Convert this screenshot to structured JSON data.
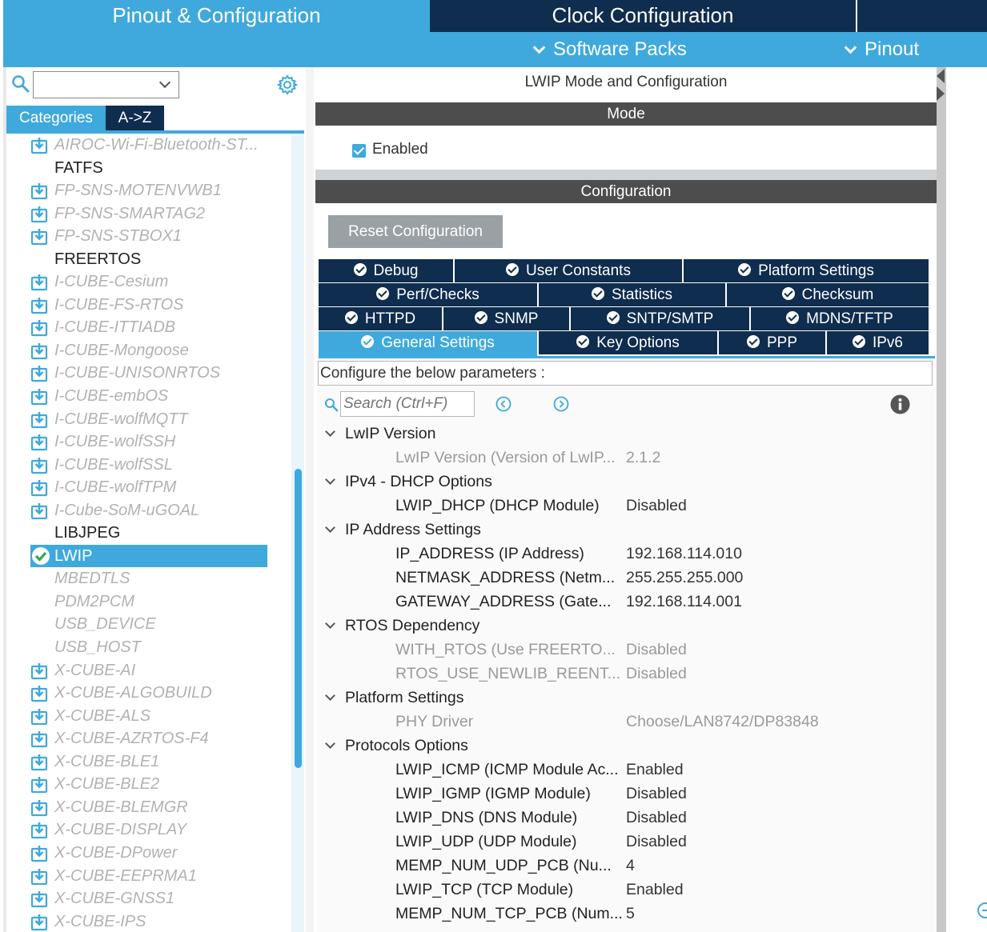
{
  "header": {
    "tab_pinout": "Pinout & Configuration",
    "tab_clock": "Clock Configuration",
    "software_packs": "Software Packs",
    "pinout": "Pinout"
  },
  "left": {
    "search_value": "",
    "tab_categories": "Categories",
    "tab_az": "A->Z",
    "items": [
      {
        "label": "AIROC-Wi-Fi-Bluetooth-ST...",
        "state": "download"
      },
      {
        "label": "FATFS",
        "state": "normal"
      },
      {
        "label": "FP-SNS-MOTENVWB1",
        "state": "download"
      },
      {
        "label": "FP-SNS-SMARTAG2",
        "state": "download"
      },
      {
        "label": "FP-SNS-STBOX1",
        "state": "download"
      },
      {
        "label": "FREERTOS",
        "state": "normal"
      },
      {
        "label": "I-CUBE-Cesium",
        "state": "download"
      },
      {
        "label": "I-CUBE-FS-RTOS",
        "state": "download"
      },
      {
        "label": "I-CUBE-ITTIADB",
        "state": "download"
      },
      {
        "label": "I-CUBE-Mongoose",
        "state": "download"
      },
      {
        "label": "I-CUBE-UNISONRTOS",
        "state": "download"
      },
      {
        "label": "I-CUBE-embOS",
        "state": "download"
      },
      {
        "label": "I-CUBE-wolfMQTT",
        "state": "download"
      },
      {
        "label": "I-CUBE-wolfSSH",
        "state": "download"
      },
      {
        "label": "I-CUBE-wolfSSL",
        "state": "download"
      },
      {
        "label": "I-CUBE-wolfTPM",
        "state": "download"
      },
      {
        "label": "I-Cube-SoM-uGOAL",
        "state": "download"
      },
      {
        "label": "LIBJPEG",
        "state": "normal"
      },
      {
        "label": "LWIP",
        "state": "selected"
      },
      {
        "label": "MBEDTLS",
        "state": "disabled"
      },
      {
        "label": "PDM2PCM",
        "state": "disabled"
      },
      {
        "label": "USB_DEVICE",
        "state": "disabled"
      },
      {
        "label": "USB_HOST",
        "state": "disabled"
      },
      {
        "label": "X-CUBE-AI",
        "state": "download"
      },
      {
        "label": "X-CUBE-ALGOBUILD",
        "state": "download"
      },
      {
        "label": "X-CUBE-ALS",
        "state": "download"
      },
      {
        "label": "X-CUBE-AZRTOS-F4",
        "state": "download"
      },
      {
        "label": "X-CUBE-BLE1",
        "state": "download"
      },
      {
        "label": "X-CUBE-BLE2",
        "state": "download"
      },
      {
        "label": "X-CUBE-BLEMGR",
        "state": "download"
      },
      {
        "label": "X-CUBE-DISPLAY",
        "state": "download"
      },
      {
        "label": "X-CUBE-DPower",
        "state": "download"
      },
      {
        "label": "X-CUBE-EEPRMA1",
        "state": "download"
      },
      {
        "label": "X-CUBE-GNSS1",
        "state": "download"
      },
      {
        "label": "X-CUBE-IPS",
        "state": "download"
      }
    ]
  },
  "right": {
    "title": "LWIP Mode and Configuration",
    "mode_header": "Mode",
    "enabled_label": "Enabled",
    "config_header": "Configuration",
    "reset_label": "Reset Configuration",
    "tabs": {
      "debug": "Debug",
      "user_constants": "User Constants",
      "platform_settings": "Platform Settings",
      "perf_checks": "Perf/Checks",
      "statistics": "Statistics",
      "checksum": "Checksum",
      "httpd": "HTTPD",
      "snmp": "SNMP",
      "sntp_smtp": "SNTP/SMTP",
      "mdns_tftp": "MDNS/TFTP",
      "general_settings": "General Settings",
      "key_options": "Key Options",
      "ppp": "PPP",
      "ipv6": "IPv6"
    },
    "configure_text": "Configure the below parameters :",
    "search_placeholder": "Search (Ctrl+F)",
    "rows": [
      {
        "type": "group",
        "label": "LwIP Version"
      },
      {
        "type": "param",
        "name": "LwIP Version (Version of LwIP...",
        "value": "2.1.2",
        "readonly": true
      },
      {
        "type": "group",
        "label": "IPv4 - DHCP Options"
      },
      {
        "type": "param",
        "name": "LWIP_DHCP (DHCP Module)",
        "value": "Disabled",
        "readonly": false
      },
      {
        "type": "group",
        "label": "IP Address Settings"
      },
      {
        "type": "param",
        "name": "IP_ADDRESS (IP Address)",
        "value": "192.168.114.010",
        "readonly": false
      },
      {
        "type": "param",
        "name": "NETMASK_ADDRESS (Netm...",
        "value": "255.255.255.000",
        "readonly": false
      },
      {
        "type": "param",
        "name": "GATEWAY_ADDRESS (Gate...",
        "value": "192.168.114.001",
        "readonly": false
      },
      {
        "type": "group",
        "label": "RTOS Dependency"
      },
      {
        "type": "param",
        "name": "WITH_RTOS (Use FREERTO...",
        "value": "Disabled",
        "readonly": true
      },
      {
        "type": "param",
        "name": "RTOS_USE_NEWLIB_REENT...",
        "value": "Disabled",
        "readonly": true
      },
      {
        "type": "group",
        "label": "Platform Settings"
      },
      {
        "type": "param",
        "name": "PHY Driver",
        "value": "Choose/LAN8742/DP83848",
        "readonly": true
      },
      {
        "type": "group",
        "label": "Protocols Options"
      },
      {
        "type": "param",
        "name": "LWIP_ICMP (ICMP Module Ac...",
        "value": "Enabled",
        "readonly": false
      },
      {
        "type": "param",
        "name": "LWIP_IGMP (IGMP Module)",
        "value": "Disabled",
        "readonly": false
      },
      {
        "type": "param",
        "name": "LWIP_DNS (DNS Module)",
        "value": "Disabled",
        "readonly": false
      },
      {
        "type": "param",
        "name": "LWIP_UDP (UDP Module)",
        "value": "Disabled",
        "readonly": false
      },
      {
        "type": "param",
        "name": "MEMP_NUM_UDP_PCB (Nu...",
        "value": "4",
        "readonly": false
      },
      {
        "type": "param",
        "name": "LWIP_TCP (TCP Module)",
        "value": "Enabled",
        "readonly": false
      },
      {
        "type": "param",
        "name": "MEMP_NUM_TCP_PCB (Num...",
        "value": "5",
        "readonly": false
      }
    ]
  },
  "colors": {
    "accent": "#3fa9dd",
    "navy": "#0f2d4e",
    "section_header": "#4d4d4d"
  }
}
